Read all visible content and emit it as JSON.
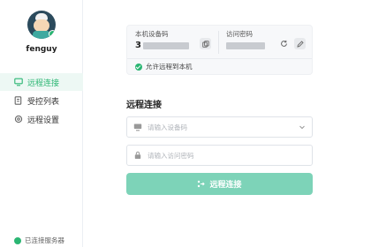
{
  "user": {
    "name": "fenguy"
  },
  "sidebar": {
    "items": [
      {
        "label": "远程连接",
        "icon": "monitor-icon",
        "active": true
      },
      {
        "label": "受控列表",
        "icon": "list-icon",
        "active": false
      },
      {
        "label": "远程设置",
        "icon": "gear-icon",
        "active": false
      }
    ],
    "status": "已连接服务器"
  },
  "device_card": {
    "id_label": "本机设备码",
    "id_value_prefix": "3",
    "password_label": "访问密码",
    "allow_text": "允许远程到本机"
  },
  "connect": {
    "title": "远程连接",
    "device_placeholder": "请输入设备码",
    "password_placeholder": "请输入访问密码",
    "button_label": "远程连接"
  },
  "colors": {
    "accent": "#2bb673",
    "button": "#7dd3b8",
    "active_bg": "#edf8f4"
  }
}
